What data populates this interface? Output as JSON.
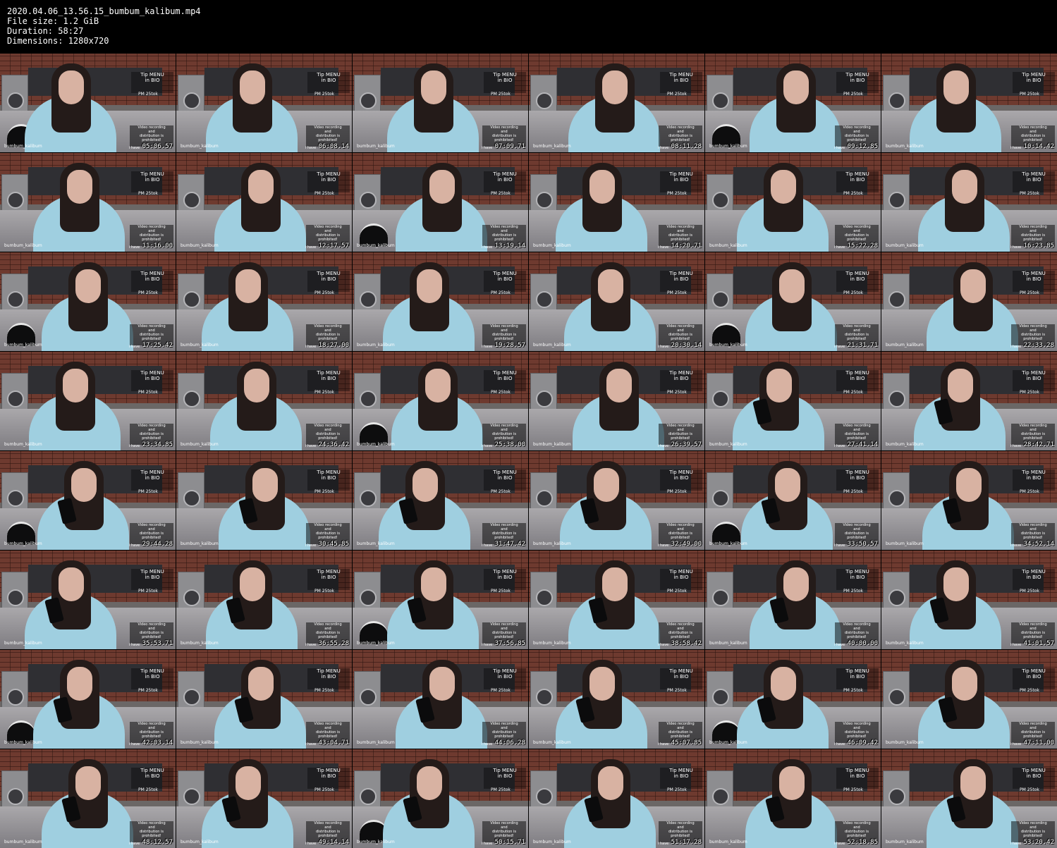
{
  "header": {
    "filename": "2020.04.06_13.56.15_bumbum_kalibum.mp4",
    "filesize": "File size: 1.2 GiB",
    "duration": "Duration: 58:27",
    "dimensions": "Dimensions: 1280x720"
  },
  "overlay": {
    "tip_line1": "Tip MENU",
    "tip_line2": "in BIO",
    "pm": "PM 25tok",
    "rec_line1": "Video recording",
    "rec_line2": "and",
    "rec_line3": "distribution is prohibited!",
    "ihave": "i have",
    "username": "bumbum_kalibum"
  },
  "thumbnails": [
    "05:06.57",
    "06:08.14",
    "07:09.71",
    "08:11.28",
    "09:12.85",
    "10:14.42",
    "11:16.00",
    "12:17.57",
    "13:19.14",
    "14:20.71",
    "15:22.28",
    "16:23.85",
    "17:25.42",
    "18:27.00",
    "19:28.57",
    "20:30.14",
    "21:31.71",
    "22:33.28",
    "23:34.85",
    "24:36.42",
    "25:38.00",
    "26:39.57",
    "27:41.14",
    "28:42.71",
    "29:44.28",
    "30:45.85",
    "31:47.42",
    "32:49.00",
    "33:50.57",
    "34:52.14",
    "35:53.71",
    "36:55.28",
    "37:56.85",
    "38:58.42",
    "40:00.00",
    "41:01.57",
    "42:03.14",
    "43:04.71",
    "44:06.28",
    "45:07.85",
    "46:09.42",
    "47:11.00",
    "48:12.57",
    "49:14.14",
    "50:15.71",
    "51:17.28",
    "52:18.85",
    "53:20.42"
  ]
}
